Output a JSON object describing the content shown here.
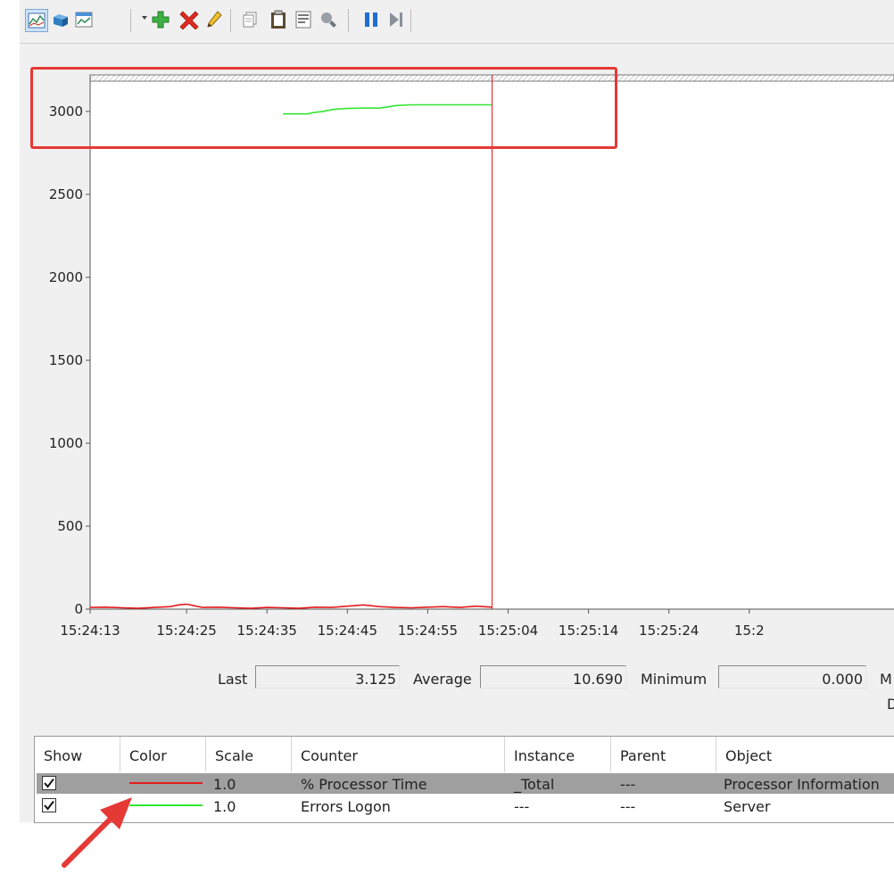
{
  "toolbar": {
    "icons": [
      "view-graph-icon",
      "view-histogram-icon",
      "change-graph-type-icon",
      "dropdown-arrow-icon",
      "add-counter-icon",
      "delete-counter-icon",
      "highlight-icon",
      "copy-properties-icon",
      "paste-counter-list-icon",
      "properties-icon",
      "zoom-icon",
      "freeze-display-icon",
      "update-data-icon"
    ]
  },
  "chart_data": {
    "type": "line",
    "y_ticks": [
      "0",
      "500",
      "1000",
      "1500",
      "2000",
      "2500",
      "3000"
    ],
    "ylim": [
      0,
      3220
    ],
    "x_ticks": [
      "15:24:13",
      "15:24:25",
      "15:24:35",
      "15:24:45",
      "15:24:55",
      "15:25:04",
      "15:25:14",
      "15:25:24",
      "15:2"
    ],
    "x_range_seconds": [
      0,
      100
    ],
    "current_time_marker": 50,
    "series": [
      {
        "counter": "% Processor Time",
        "color": "#e31a1c",
        "x": [
          0,
          2,
          4,
          6,
          8,
          10,
          11,
          12,
          13,
          14,
          16,
          18,
          20,
          22,
          24,
          26,
          28,
          30,
          32,
          34,
          36,
          38,
          40,
          42,
          44,
          46,
          48,
          50
        ],
        "y": [
          10,
          12,
          8,
          5,
          10,
          15,
          25,
          30,
          20,
          10,
          12,
          8,
          5,
          10,
          8,
          5,
          12,
          10,
          18,
          25,
          15,
          10,
          8,
          12,
          15,
          10,
          18,
          12
        ]
      },
      {
        "counter": "Errors Logon",
        "color": "#33e633",
        "x": [
          24,
          27,
          28,
          29,
          30,
          31,
          32,
          34,
          36,
          38,
          40,
          42,
          44,
          46,
          48,
          50
        ],
        "y": [
          2985,
          2985,
          2995,
          3000,
          3010,
          3015,
          3018,
          3020,
          3020,
          3035,
          3040,
          3040,
          3040,
          3040,
          3040,
          3040
        ]
      }
    ]
  },
  "stats": {
    "last_label": "Last",
    "last_value": "3.125",
    "average_label": "Average",
    "average_value": "10.690",
    "minimum_label": "Minimum",
    "minimum_value": "0.000",
    "maximum_label_clipped": "M",
    "duration_label_clipped": "D"
  },
  "legend": {
    "headers": {
      "show": "Show",
      "color": "Color",
      "scale": "Scale",
      "counter": "Counter",
      "instance": "Instance",
      "parent": "Parent",
      "object": "Object"
    },
    "rows": [
      {
        "checked": true,
        "color": "#e31a1c",
        "scale": "1.0",
        "counter": "% Processor Time",
        "instance": "_Total",
        "parent": "---",
        "object": "Processor Information"
      },
      {
        "checked": true,
        "color": "#33e633",
        "scale": "1.0",
        "counter": "Errors Logon",
        "instance": "---",
        "parent": "---",
        "object": "Server"
      }
    ]
  },
  "annotations": {
    "highlight_box_color": "#e53935",
    "arrow_color": "#e53935"
  }
}
